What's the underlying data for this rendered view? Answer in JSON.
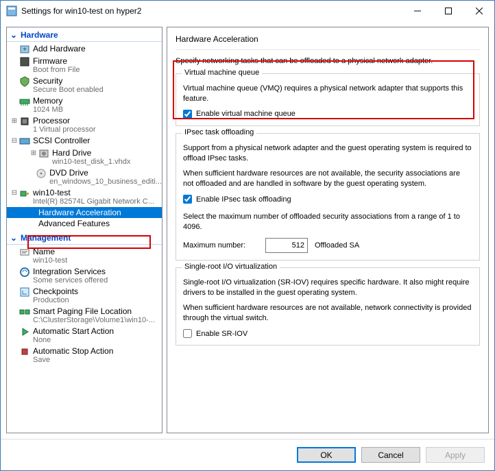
{
  "window": {
    "title": "Settings for win10-test on hyper2"
  },
  "sections": {
    "hardware": "Hardware",
    "management": "Management"
  },
  "tree": {
    "add_hardware": "Add Hardware",
    "firmware": {
      "label": "Firmware",
      "sub": "Boot from File"
    },
    "security": {
      "label": "Security",
      "sub": "Secure Boot enabled"
    },
    "memory": {
      "label": "Memory",
      "sub": "1024 MB"
    },
    "processor": {
      "label": "Processor",
      "sub": "1 Virtual processor"
    },
    "scsi": {
      "label": "SCSI Controller"
    },
    "hdd": {
      "label": "Hard Drive",
      "sub": "win10-test_disk_1.vhdx"
    },
    "dvd": {
      "label": "DVD Drive",
      "sub": "en_windows_10_business_editi..."
    },
    "nic": {
      "label": "win10-test",
      "sub": "Intel(R) 82574L Gigabit Network C..."
    },
    "hwaccel": "Hardware Acceleration",
    "advfeat": "Advanced Features",
    "name": {
      "label": "Name",
      "sub": "win10-test"
    },
    "intsvc": {
      "label": "Integration Services",
      "sub": "Some services offered"
    },
    "checkpoints": {
      "label": "Checkpoints",
      "sub": "Production"
    },
    "paging": {
      "label": "Smart Paging File Location",
      "sub": "C:\\ClusterStorage\\Volume1\\win10-..."
    },
    "autostart": {
      "label": "Automatic Start Action",
      "sub": "None"
    },
    "autostop": {
      "label": "Automatic Stop Action",
      "sub": "Save"
    }
  },
  "right": {
    "title": "Hardware Acceleration",
    "intro": "Specify networking tasks that can be offloaded to a physical network adapter.",
    "vmq": {
      "legend": "Virtual machine queue",
      "text": "Virtual machine queue (VMQ) requires a physical network adapter that supports this feature.",
      "checkbox": "Enable virtual machine queue",
      "checked": true
    },
    "ipsec": {
      "legend": "IPsec task offloading",
      "text1": "Support from a physical network adapter and the guest operating system is required to offload IPsec tasks.",
      "text2": "When sufficient hardware resources are not available, the security associations are not offloaded and are handled in software by the guest operating system.",
      "checkbox": "Enable IPsec task offloading",
      "checked": true,
      "range_text": "Select the maximum number of offloaded security associations from a range of 1 to 4096.",
      "max_label": "Maximum number:",
      "max_value": "512",
      "suffix": "Offloaded SA"
    },
    "sriov": {
      "legend": "Single-root I/O virtualization",
      "text1": "Single-root I/O virtualization (SR-IOV) requires specific hardware. It also might require drivers to be installed in the guest operating system.",
      "text2": "When sufficient hardware resources are not available, network connectivity is provided through the virtual switch.",
      "checkbox": "Enable SR-IOV",
      "checked": false
    }
  },
  "buttons": {
    "ok": "OK",
    "cancel": "Cancel",
    "apply": "Apply"
  }
}
